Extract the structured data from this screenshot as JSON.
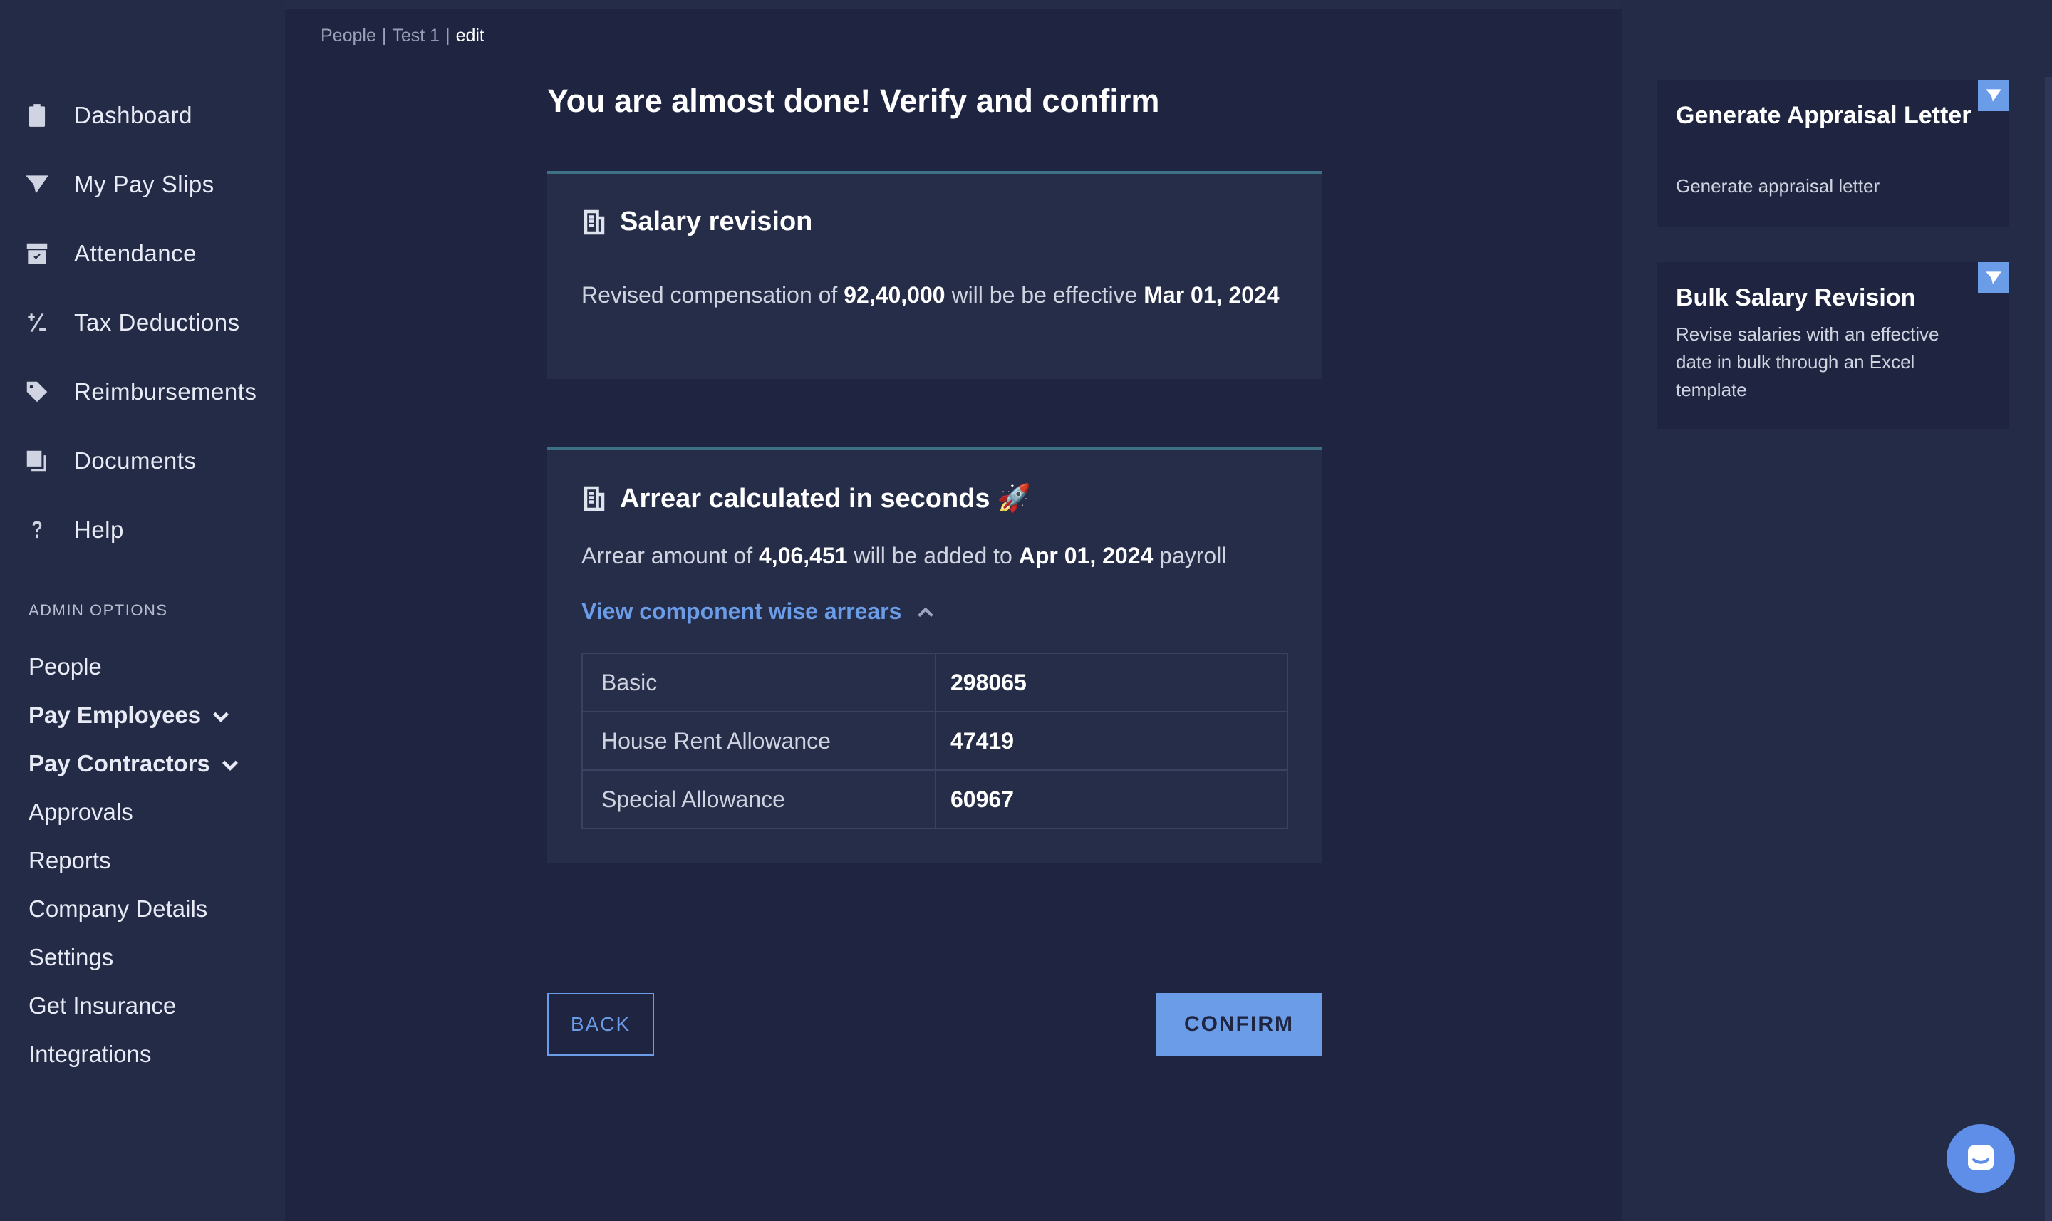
{
  "sidebar": {
    "items": [
      {
        "label": "Dashboard",
        "icon": "clipboard-icon"
      },
      {
        "label": "My Pay Slips",
        "icon": "paper-plane-icon"
      },
      {
        "label": "Attendance",
        "icon": "calendar-check-icon"
      },
      {
        "label": "Tax Deductions",
        "icon": "plus-minus-icon"
      },
      {
        "label": "Reimbursements",
        "icon": "tag-icon"
      },
      {
        "label": "Documents",
        "icon": "documents-icon"
      },
      {
        "label": "Help",
        "icon": "question-icon"
      }
    ],
    "admin_title": "ADMIN OPTIONS",
    "admin_items": [
      {
        "label": "People"
      },
      {
        "label": "Pay Employees"
      },
      {
        "label": "Pay Contractors"
      },
      {
        "label": "Approvals"
      },
      {
        "label": "Reports"
      },
      {
        "label": "Company Details"
      },
      {
        "label": "Settings"
      },
      {
        "label": "Get Insurance"
      },
      {
        "label": "Integrations"
      }
    ]
  },
  "breadcrumb": {
    "people": "People",
    "sep1": "|",
    "employee": "Test 1",
    "sep2": "|",
    "current": "edit"
  },
  "main": {
    "title": "You are almost done! Verify and confirm",
    "salary_card": {
      "title": "Salary revision",
      "text_prefix": "Revised compensation of ",
      "amount": "92,40,000",
      "text_mid": " will be be effective ",
      "date": "Mar 01, 2024"
    },
    "arrear_card": {
      "title": "Arrear calculated in seconds",
      "title_emoji": "🚀",
      "text_prefix": "Arrear amount of ",
      "amount": "4,06,451",
      "text_mid": " will be added to ",
      "date": "Apr 01, 2024",
      "text_suffix": " payroll",
      "view_link": "View component wise arrears",
      "rows": [
        {
          "component": "Basic",
          "value": "298065"
        },
        {
          "component": "House Rent Allowance",
          "value": "47419"
        },
        {
          "component": "Special Allowance",
          "value": "60967"
        }
      ]
    },
    "back_label": "BACK",
    "confirm_label": "CONFIRM"
  },
  "right_panel": {
    "promo1": {
      "title": "Generate Appraisal Letter",
      "desc": "Generate appraisal letter"
    },
    "promo2": {
      "title": "Bulk Salary Revision",
      "desc": "Revise salaries with an effective date in bulk through an Excel template"
    }
  },
  "colors": {
    "accent": "#6b9ce8",
    "background": "#1f2540",
    "sidebar": "#242b46",
    "card": "#262d48",
    "card_border": "#3d6f85"
  }
}
